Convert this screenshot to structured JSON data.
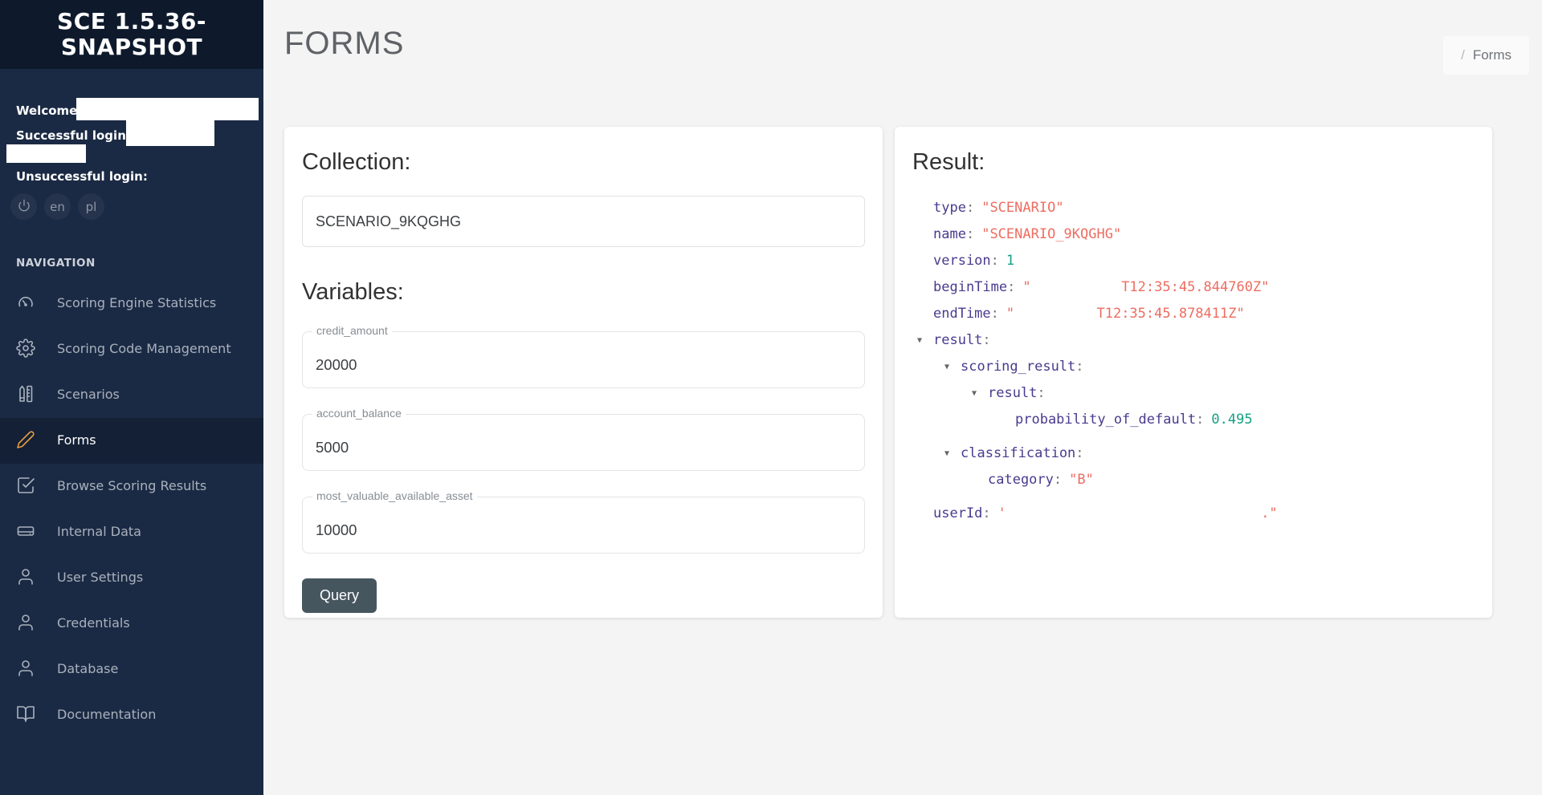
{
  "sidebar": {
    "title": "SCE 1.5.36-SNAPSHOT",
    "welcome_label": "Welcome,",
    "successful_login_label": "Successful login:",
    "unsuccessful_login_label": "Unsuccessful login:",
    "lang_buttons": {
      "en": "en",
      "pl": "pl"
    },
    "nav_header": "NAVIGATION",
    "nav_items": [
      {
        "label": "Scoring Engine Statistics",
        "icon": "gauge-icon",
        "active": false
      },
      {
        "label": "Scoring Code Management",
        "icon": "gear-icon",
        "active": false
      },
      {
        "label": "Scenarios",
        "icon": "pencil-ruler-icon",
        "active": false
      },
      {
        "label": "Forms",
        "icon": "pen-icon",
        "active": true
      },
      {
        "label": "Browse Scoring Results",
        "icon": "check-square-icon",
        "active": false
      },
      {
        "label": "Internal Data",
        "icon": "hard-drive-icon",
        "active": false
      },
      {
        "label": "User Settings",
        "icon": "user-icon",
        "active": false
      },
      {
        "label": "Credentials",
        "icon": "user-icon",
        "active": false
      },
      {
        "label": "Database",
        "icon": "user-icon",
        "active": false
      },
      {
        "label": "Documentation",
        "icon": "book-open-icon",
        "active": false
      }
    ],
    "colors": {
      "bg": "#1b2a44",
      "header_bg": "#0e1a2c",
      "active_bg": "#132036",
      "accent": "#e59b40"
    }
  },
  "header": {
    "title": "FORMS",
    "breadcrumb_separator": "/",
    "breadcrumb_current": "Forms"
  },
  "collection_panel": {
    "collection_label": "Collection:",
    "collection_value": "SCENARIO_9KQGHG",
    "variables_label": "Variables:",
    "fields": [
      {
        "label": "credit_amount",
        "value": "20000"
      },
      {
        "label": "account_balance",
        "value": "5000"
      },
      {
        "label": "most_valuable_available_asset",
        "value": "10000"
      }
    ],
    "query_button_label": "Query"
  },
  "result_panel": {
    "title": "Result:",
    "colors": {
      "key": "#4a3a8e",
      "string": "#ed6d61",
      "number": "#16a085"
    },
    "json_lines": [
      {
        "key": "type",
        "value": "\"SCENARIO\"",
        "value_type": "string",
        "indent": 0,
        "expandable": false
      },
      {
        "key": "name",
        "value": "\"SCENARIO_9KQGHG\"",
        "value_type": "string",
        "indent": 0,
        "expandable": false
      },
      {
        "key": "version",
        "value": "1",
        "value_type": "number",
        "indent": 0,
        "expandable": false
      },
      {
        "key": "beginTime",
        "value": "\"           T12:35:45.844760Z\"",
        "value_type": "string",
        "indent": 0,
        "expandable": false
      },
      {
        "key": "endTime",
        "value": "\"          T12:35:45.878411Z\"",
        "value_type": "string",
        "indent": 0,
        "expandable": false
      },
      {
        "key": "result",
        "value": "",
        "value_type": "none",
        "indent": 0,
        "expandable": true
      },
      {
        "key": "scoring_result",
        "value": "",
        "value_type": "none",
        "indent": 1,
        "expandable": true
      },
      {
        "key": "result",
        "value": "",
        "value_type": "none",
        "indent": 2,
        "expandable": true
      },
      {
        "key": "probability_of_default",
        "value": "0.495",
        "value_type": "number",
        "indent": 3,
        "expandable": false
      },
      {
        "key": "classification",
        "value": "",
        "value_type": "none",
        "indent": 1,
        "expandable": true
      },
      {
        "key": "category",
        "value": "\"B\"",
        "value_type": "string",
        "indent": 2,
        "expandable": false
      },
      {
        "key": "userId",
        "value": "'                               .\"",
        "value_type": "string",
        "indent": 0,
        "expandable": false
      }
    ]
  }
}
